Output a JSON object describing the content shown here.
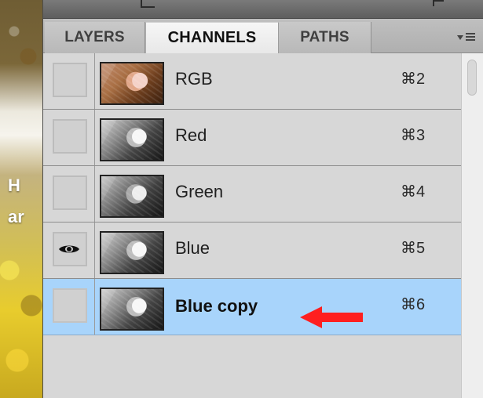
{
  "background": {
    "text_top": "H",
    "text_bottom": "ar"
  },
  "panel": {
    "tabs": [
      {
        "label": "LAYERS"
      },
      {
        "label": "CHANNELS",
        "active": true
      },
      {
        "label": "PATHS"
      }
    ],
    "menu_icon": "panel-menu-icon",
    "channels": [
      {
        "name": "RGB",
        "shortcut": "⌘2",
        "visible": false,
        "selected": false,
        "thumbnail": "color"
      },
      {
        "name": "Red",
        "shortcut": "⌘3",
        "visible": false,
        "selected": false,
        "thumbnail": "grayscale"
      },
      {
        "name": "Green",
        "shortcut": "⌘4",
        "visible": false,
        "selected": false,
        "thumbnail": "grayscale"
      },
      {
        "name": "Blue",
        "shortcut": "⌘5",
        "visible": true,
        "selected": false,
        "thumbnail": "grayscale"
      },
      {
        "name": "Blue copy",
        "shortcut": "⌘6",
        "visible": false,
        "selected": true,
        "thumbnail": "grayscale"
      }
    ]
  },
  "annotation": {
    "arrow_icon": "red-arrow-icon",
    "arrow_color": "#ff1f1f"
  },
  "colors": {
    "panel_background": "#d7d7d7",
    "selected_row": "#a8d4fb",
    "active_tab": "#f2f2f2"
  }
}
